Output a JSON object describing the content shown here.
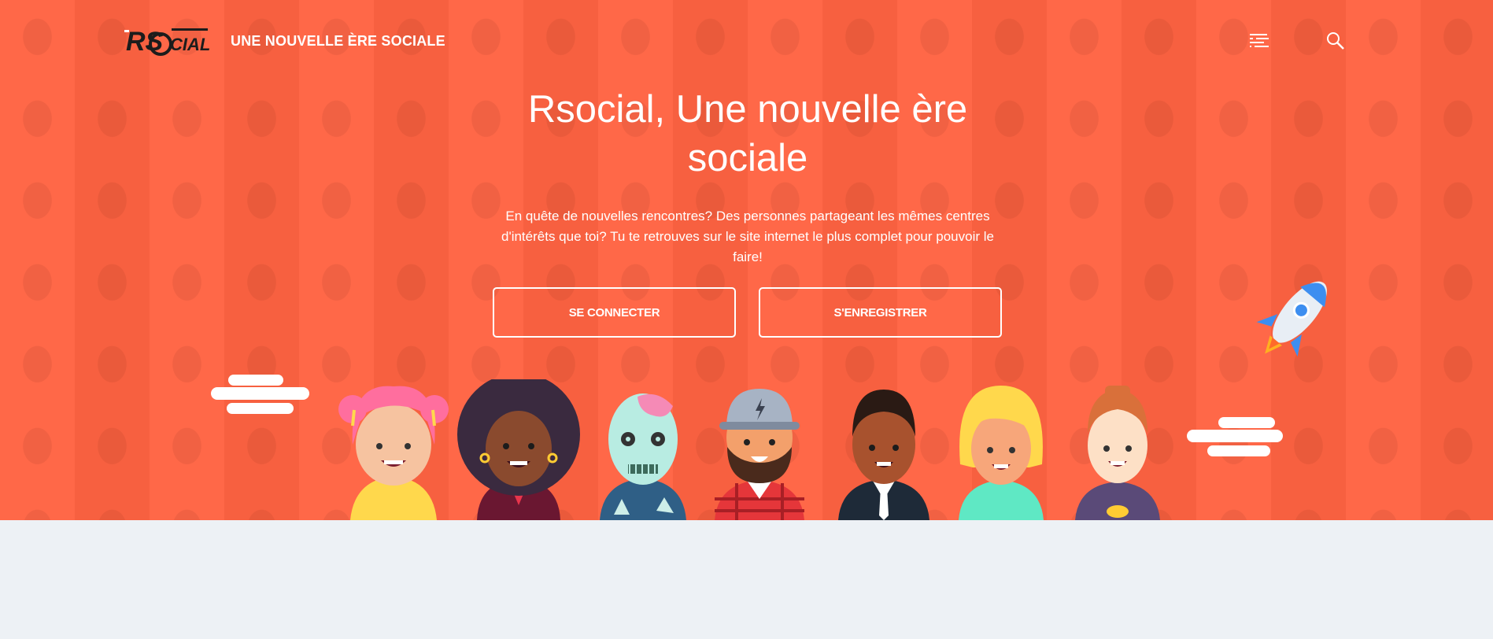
{
  "header": {
    "logo_text": "RSOCIAL",
    "tagline": "UNE NOUVELLE ÈRE SOCIALE",
    "menu_icon": "menu-icon",
    "search_icon": "search-icon"
  },
  "hero": {
    "title": "Rsocial, Une nouvelle ère sociale",
    "subtitle": "En quête de nouvelles rencontres? Des personnes partageant les mêmes centres d'intérêts que toi? Tu te retrouves sur le site internet le plus complet pour pouvoir le faire!",
    "buttons": {
      "login": "SE CONNECTER",
      "register": "S'ENREGISTRER"
    }
  },
  "colors": {
    "hero_bg": "#ff6342",
    "page_bg": "#edf1f5",
    "text": "#ffffff"
  },
  "illustration": {
    "characters": [
      "pink-hair-girl",
      "curly-hair-woman",
      "zombie",
      "bearded-cap-man",
      "man-with-tie",
      "blonde-woman",
      "red-hair-boy"
    ],
    "extras": [
      "cloud-left",
      "cloud-right",
      "rocket"
    ]
  }
}
